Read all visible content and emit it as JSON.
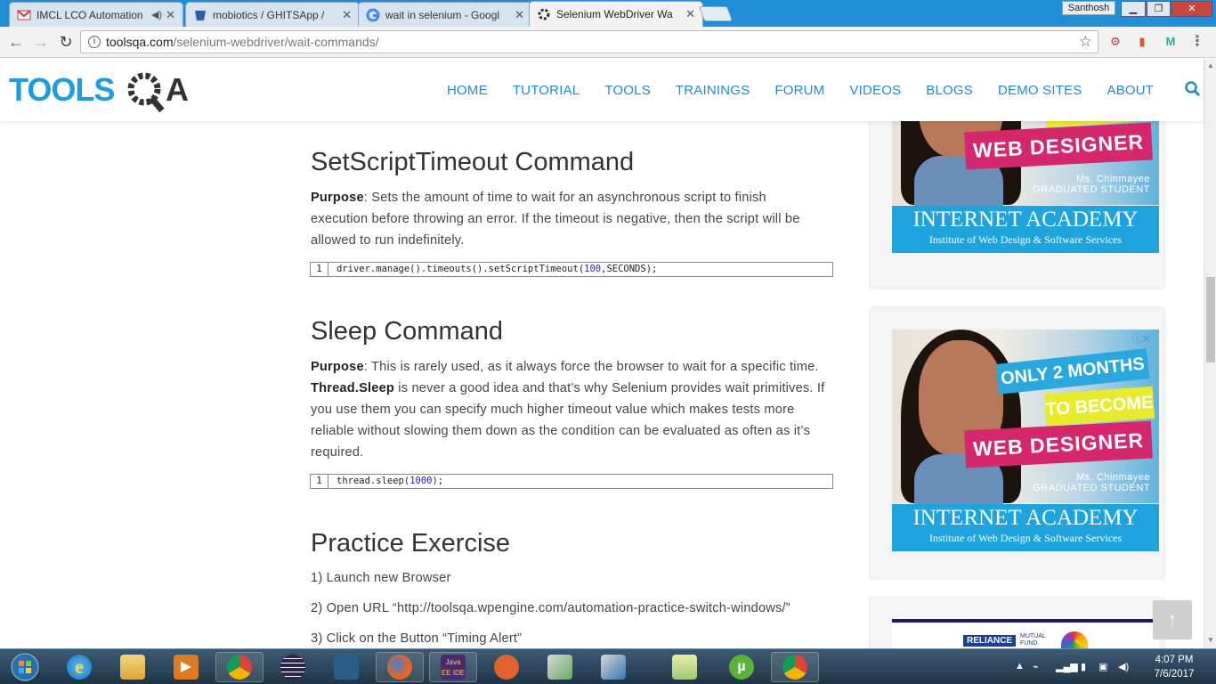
{
  "browser": {
    "tabs": [
      {
        "title": "IMCL LCO Automation",
        "icon": "gmail-icon"
      },
      {
        "title": "mobiotics / GHITSApp / ",
        "icon": "bitbucket-icon"
      },
      {
        "title": "wait in selenium - Googl",
        "icon": "google-icon"
      },
      {
        "title": "Selenium WebDriver Wa",
        "icon": "toolsqa-icon",
        "active": true
      }
    ],
    "user": "Santhosh",
    "url_host": "toolsqa.com",
    "url_path": "/selenium-webdriver/wait-commands/"
  },
  "site": {
    "logo_text": "TOOLSQA",
    "nav": [
      "HOME",
      "TUTORIAL",
      "TOOLS",
      "TRAININGS",
      "FORUM",
      "VIDEOS",
      "BLOGS",
      "DEMO SITES",
      "ABOUT"
    ]
  },
  "article": {
    "section1": {
      "title": "SetScriptTimeout Command",
      "purpose_label": "Purpose",
      "purpose_text": ": Sets the amount of time to wait for an asynchronous script to finish execution before throwing an error. If the timeout is negative, then the script will be allowed to run indefinitely.",
      "code_line": "1",
      "code_pre": "driver.manage().timeouts().setScriptTimeout(",
      "code_num": "100",
      "code_post": ",SECONDS);"
    },
    "section2": {
      "title": "Sleep Command",
      "purpose_label": "Purpose",
      "text_a": ": This is rarely used, as it always force the browser to wait for a specific time. ",
      "bold": "Thread.Sleep",
      "text_b": " is never a good idea and that’s why Selenium provides wait primitives. If you use them you can specify much higher timeout value which makes tests more reliable without slowing them down as the condition can be evaluated as often as it’s required.",
      "code_line": "1",
      "code_pre": "thread.sleep(",
      "code_num": "1000",
      "code_post": ");"
    },
    "section3": {
      "title": "Practice Exercise",
      "steps": [
        "1) Launch new Browser",
        "2) Open URL “http://toolsqa.wpengine.com/automation-practice-switch-windows/”",
        "3) Click on the Button “Timing Alert”"
      ]
    }
  },
  "ads": {
    "banner1": "ONLY 2 MONTHS",
    "banner2": "TO BECOME",
    "banner3": "WEB DESIGNER",
    "caption1": "Ms. Chinmayee",
    "caption2": "GRADUATED STUDENT",
    "footer_title": "INTERNET ACADEMY",
    "footer_sub": "Institute of Web Design & Software Services",
    "third_ad_brand": "RELIANCE",
    "third_ad_sub": "MUTUAL FUND"
  },
  "taskbar": {
    "time": "4:07 PM",
    "date": "7/6/2017",
    "apps": [
      "start-orb",
      "internet-explorer-icon",
      "file-explorer-icon",
      "media-player-icon",
      "chrome-icon",
      "eclipse-icon",
      "mysql-workbench-icon",
      "firefox-icon",
      "javaee-ide-icon",
      "tools-icon",
      "network-icon",
      "remote-desktop-icon",
      "folder-icon",
      "utorrent-icon",
      "chrome-icon"
    ]
  },
  "colors": {
    "accent": "#1e88d4",
    "ad_pink": "#d6266c",
    "ad_blue": "#1da3de",
    "ad_yellow": "#e6ec2a"
  }
}
